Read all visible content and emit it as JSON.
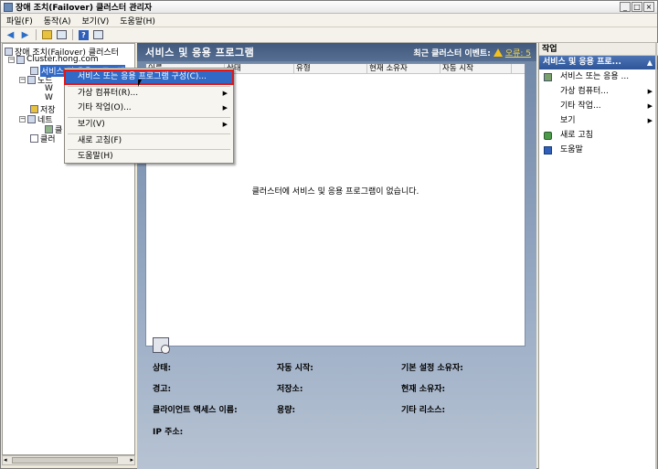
{
  "window": {
    "title": "장애 조치(Failover) 클러스터 관리자",
    "controls": [
      "_",
      "□",
      "×"
    ]
  },
  "menu": [
    "파일(F)",
    "동작(A)",
    "보기(V)",
    "도움말(H)"
  ],
  "tree": {
    "root": "장애 조치(Failover) 클러스터",
    "cluster": "Cluster.hong.com",
    "services": "서비스 및 응용 프로그램",
    "nodes": "노드",
    "node_children": [
      "W",
      "W"
    ],
    "storage": "저장",
    "networks": "네트",
    "network_child": "클",
    "events": "클러"
  },
  "center": {
    "title": "서비스 및 응용 프로그램",
    "events_label": "최근 클러스터 이벤트:",
    "events_error": "오류: 5",
    "columns": [
      "이름",
      "상태",
      "유형",
      "현재 소유자",
      "자동 시작"
    ],
    "empty_message": "클러스터에 서비스 및 응용 프로그램이 없습니다.",
    "properties": {
      "status": "상태:",
      "alert": "경고:",
      "client_access": "클라이언트 액세스 이름:",
      "ip": "IP 주소:",
      "auto_start": "자동 시작:",
      "storage": "저장소:",
      "capacity": "용량:",
      "preferred_owner": "기본 설정 소유자:",
      "current_owner": "현재 소유자:",
      "other_resources": "기타 리소스:"
    }
  },
  "actions": {
    "header": "작업",
    "section": "서비스 및 응용 프로...",
    "items": [
      "서비스 또는 응용 ...",
      "가상 컴퓨터...",
      "기타 작업...",
      "보기",
      "새로 고침",
      "도움말"
    ]
  },
  "context_menu": {
    "items": [
      "서비스 또는 응용 프로그램 구성(C)...",
      "가상 컴퓨터(R)...",
      "기타 작업(O)...",
      "보기(V)",
      "새로 고침(F)",
      "도움말(H)"
    ]
  }
}
